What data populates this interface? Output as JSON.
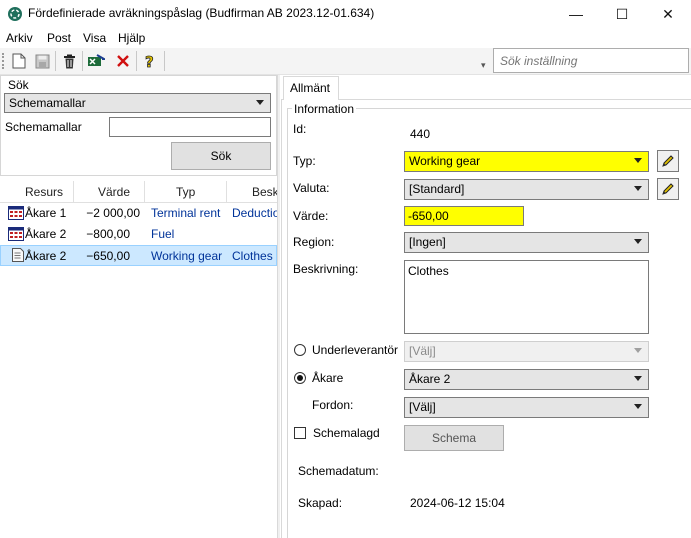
{
  "window": {
    "title": "Fördefinierade avräkningspåslag (Budfirman AB 2023.12-01.634)",
    "minimize": "—",
    "maximize": "☐",
    "close": "✕"
  },
  "menu": [
    "Arkiv",
    "Post",
    "Visa",
    "Hjälp"
  ],
  "toolbar": {
    "icons": [
      "new-document-icon",
      "save-icon",
      "delete-icon",
      "excel-export-icon",
      "cancel-icon",
      "help-icon"
    ],
    "search_placeholder": "Sök inställning"
  },
  "search_panel": {
    "group_label": "Sök",
    "type_selected": "Schemamallar",
    "field_label": "Schemamallar",
    "field_value": "",
    "search_button": "Sök"
  },
  "grid": {
    "columns": [
      "Resurs",
      "Värde",
      "Typ",
      "Besk"
    ],
    "rows": [
      {
        "resurs": "Åkare 1",
        "varde": "−2 000,00",
        "typ": "Terminal rent",
        "besk": "Deductio"
      },
      {
        "resurs": "Åkare 2",
        "varde": "−800,00",
        "typ": "Fuel",
        "besk": ""
      },
      {
        "resurs": "Åkare 2",
        "varde": "−650,00",
        "typ": "Working gear",
        "besk": "Clothes"
      }
    ]
  },
  "details": {
    "tab": "Allmänt",
    "group_label": "Information",
    "id_label": "Id:",
    "id_value": "440",
    "typ_label": "Typ:",
    "typ_value": "Working gear",
    "valuta_label": "Valuta:",
    "valuta_value": "[Standard]",
    "varde_label": "Värde:",
    "varde_value": "-650,00",
    "region_label": "Region:",
    "region_value": "[Ingen]",
    "beskrivning_label": "Beskrivning:",
    "beskrivning_value": "Clothes",
    "underleverantor_label": "Underleverantör",
    "underleverantor_value": "[Välj]",
    "akare_label": "Åkare",
    "akare_value": "Åkare 2",
    "fordon_label": "Fordon:",
    "fordon_value": "[Välj]",
    "schemalagd_label": "Schemalagd",
    "schema_button": "Schema",
    "schemadatum_label": "Schemadatum:",
    "schemadatum_value": "",
    "skapad_label": "Skapad:",
    "skapad_value": "2024-06-12 15:04"
  },
  "colors": {
    "highlight": "#ffff00",
    "selection": "#cce8ff",
    "accent_blue": "#003399"
  }
}
